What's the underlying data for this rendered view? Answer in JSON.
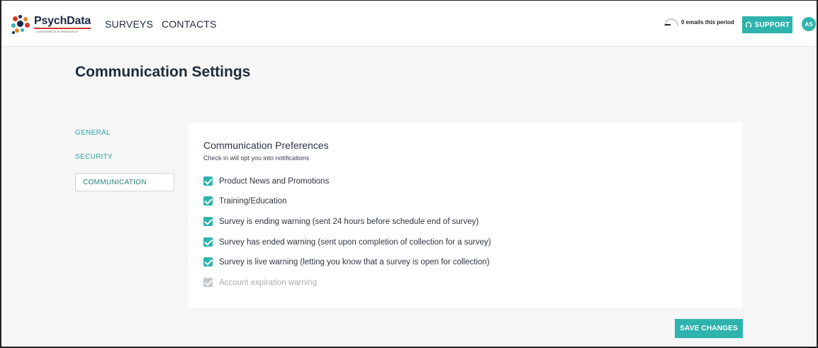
{
  "header": {
    "logo_text": "PsychData",
    "logo_tagline": "CONFIDENCE IN RESEARCH",
    "nav": [
      {
        "label": "SURVEYS"
      },
      {
        "label": "CONTACTS"
      }
    ],
    "quota_text": "0 emails this period",
    "support_label": "SUPPORT",
    "avatar_initials": "AS"
  },
  "page": {
    "title": "Communication Settings"
  },
  "sidebar": {
    "items": [
      {
        "label": "GENERAL",
        "active": false
      },
      {
        "label": "SECURITY",
        "active": false
      },
      {
        "label": "COMMUNICATION",
        "active": true
      }
    ]
  },
  "panel": {
    "title": "Communication Preferences",
    "subtitle": "Check in will opt you into notifications",
    "preferences": [
      {
        "label": "Product News and Promotions",
        "checked": true,
        "disabled": false
      },
      {
        "label": "Training/Education",
        "checked": true,
        "disabled": false
      },
      {
        "label": "Survey is ending warning (sent 24 hours before schedule end of survey)",
        "checked": true,
        "disabled": false
      },
      {
        "label": "Survey has ended warning (sent upon completion of collection for a survey)",
        "checked": true,
        "disabled": false
      },
      {
        "label": "Survey is live warning (letting you know that a survey is open for collection)",
        "checked": true,
        "disabled": false
      },
      {
        "label": "Account expiration warning",
        "checked": true,
        "disabled": true
      }
    ]
  },
  "actions": {
    "save_label": "SAVE CHANGES"
  },
  "colors": {
    "accent": "#2fb3ad",
    "background": "#f6f6f6"
  }
}
